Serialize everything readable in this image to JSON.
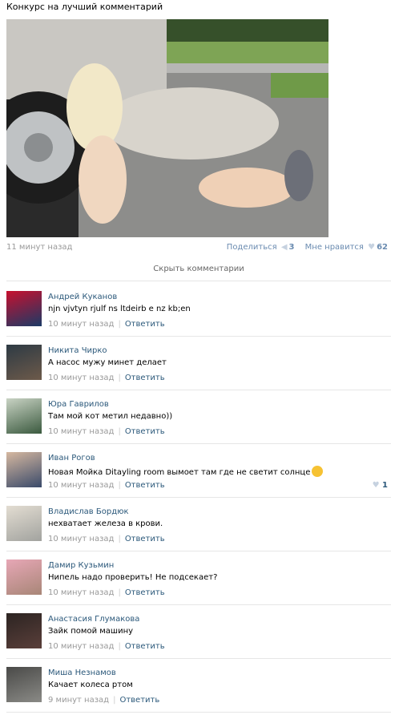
{
  "post": {
    "title": "Конкурс на лучший комментарий",
    "time": "11 минут назад",
    "share_label": "Поделиться",
    "share_count": "3",
    "like_label": "Мне нравится",
    "like_count": "62"
  },
  "hide_comments_label": "Скрыть комментарии",
  "reply_label": "Ответить",
  "comments": [
    {
      "name": "Андрей Куканов",
      "text": "njn vjvtyn rjulf ns ltdeirb e nz kb;en",
      "time": "10 минут назад",
      "likes": ""
    },
    {
      "name": "Никита Чирко",
      "text": "А насос мужу минет делает",
      "time": "10 минут назад",
      "likes": ""
    },
    {
      "name": "Юра Гаврилов",
      "text": "Там мой кот метил недавно))",
      "time": "10 минут назад",
      "likes": ""
    },
    {
      "name": "Иван Рогов",
      "text": "Новая Мойка Ditayling room вымоет там где не светит солнце",
      "time": "10 минут назад",
      "likes": "1"
    },
    {
      "name": "Владислав Бордюк",
      "text": "нехватает железа в крови.",
      "time": "10 минут назад",
      "likes": ""
    },
    {
      "name": "Дамир Кузьмин",
      "text": "Нипель надо проверить! Не подсекает?",
      "time": "10 минут назад",
      "likes": ""
    },
    {
      "name": "Анастасия Глумакова",
      "text": "Зайк помой машину",
      "time": "10 минут назад",
      "likes": ""
    },
    {
      "name": "Миша Незнамов",
      "text": "Качает колеса ртом",
      "time": "9 минут назад",
      "likes": ""
    }
  ],
  "colors": {
    "link": "#2b587a",
    "meta": "#999999",
    "accent": "#6a8bb0",
    "divider": "#e6e6e6"
  }
}
